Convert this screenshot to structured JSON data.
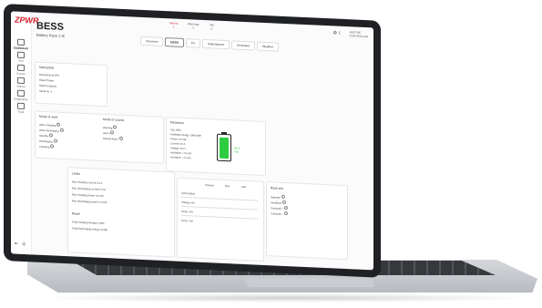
{
  "brand": {
    "logo": "ZPWR",
    "accent": "#d81e2a",
    "battery_color": "#2ecc40"
  },
  "sidebar": {
    "items": [
      {
        "label": "Dashboard",
        "icon": "grid-icon"
      },
      {
        "label": "Plot",
        "icon": "plot-icon"
      },
      {
        "label": "Events",
        "icon": "events-icon"
      },
      {
        "label": "Alarms",
        "icon": "bell-icon"
      },
      {
        "label": "Diagnostics",
        "icon": "diagnostics-icon"
      },
      {
        "label": "Fleet",
        "icon": "fleet-icon"
      }
    ]
  },
  "status": [
    {
      "label": "Alarms",
      "count": "1"
    },
    {
      "label": "Warnings",
      "count": "2"
    },
    {
      "label": "Info",
      "count": "0"
    }
  ],
  "user": {
    "line1": "ANOTHE",
    "line2": "CONTROLLER"
  },
  "page": {
    "title": "BESS",
    "subtitle": "Battery Rack 1"
  },
  "tabs": [
    "Overview",
    "BESS",
    "PV",
    "Switchboard",
    "Generator",
    "Weather"
  ],
  "nameplate": {
    "title": "Nameplate",
    "rows": [
      "Manufacturer   BPL",
      "Rated Power",
      "Rated Capacity",
      "Serial no.   0"
    ]
  },
  "mode_of_work": {
    "title": "Mode of work",
    "rows": [
      "Allow charging",
      "Allow discharging",
      "Standby",
      "Discharging",
      "Charging"
    ]
  },
  "mode_of_source": {
    "title": "Mode of source",
    "rows": [
      "Warning",
      "Alarm",
      "Default Alarm"
    ]
  },
  "measures": {
    "title": "Measures",
    "rows": [
      "SoC   88%",
      "Available energy   1088 kWh",
      "Power   0.0 kW",
      "Current   0.0 A",
      "Voltage   701 V",
      "Insulation +   0.0 kΩ",
      "Insulation -   0.0 kΩ"
    ],
    "percent": "88 %",
    "state": "Full",
    "soc_level": 0.88
  },
  "limits": {
    "title": "Limits",
    "rows": [
      "Max charging current   0.0 A",
      "Max discharging current   0.0 A",
      "Max charging power   0.0 kW",
      "Max discharging power   0.0 kW"
    ],
    "subtitle": "Reset",
    "rows2": [
      "Total charging energy   0 kWh",
      "Total discharging energy   0 kWh"
    ]
  },
  "temps": {
    "headers": [
      "",
      "Present",
      "Roll",
      "Cell"
    ],
    "rows": [
      "Cell position",
      "Voltage min",
      "Temp. min",
      "Temp. min"
    ]
  },
  "rack": {
    "title": "Rack info",
    "rows": [
      "Operator",
      "Feedback",
      "Contactor +",
      "Contactor -"
    ]
  }
}
